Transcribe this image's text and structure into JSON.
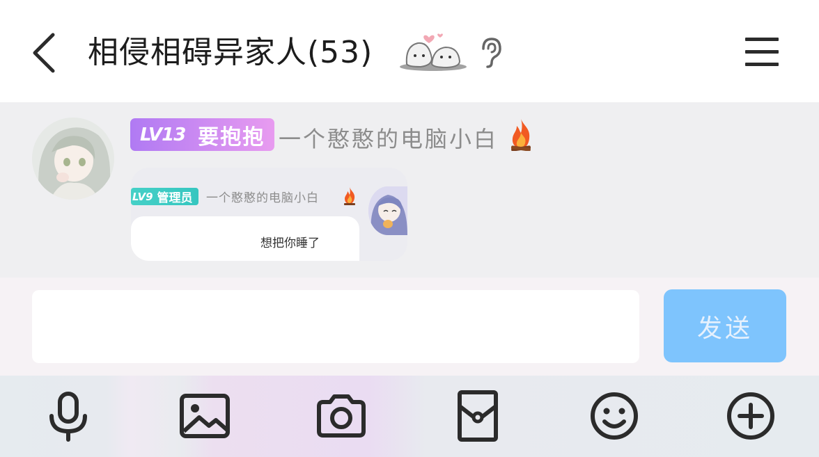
{
  "header": {
    "title": "相侵相碍异家人(53)"
  },
  "message": {
    "level_badge": "LV13",
    "title_badge": "要抱抱",
    "nickname": "一个憨憨的电脑小白",
    "quoted": {
      "level_badge": "LV9",
      "role_badge": "管理员",
      "nickname": "一个憨憨的电脑小白",
      "text": "想把你睡了"
    }
  },
  "composer": {
    "input_value": "",
    "send_label": "发送"
  },
  "toolbar": {
    "icons": [
      "microphone-icon",
      "image-icon",
      "camera-icon",
      "red-packet-icon",
      "emoji-icon",
      "plus-icon"
    ]
  },
  "colors": {
    "badge_purple_start": "#b07af3",
    "badge_purple_end": "#e89bf0",
    "admin_badge_teal": "#40ccc4",
    "send_button": "#7ec4fd",
    "chat_background": "#efeff1"
  }
}
